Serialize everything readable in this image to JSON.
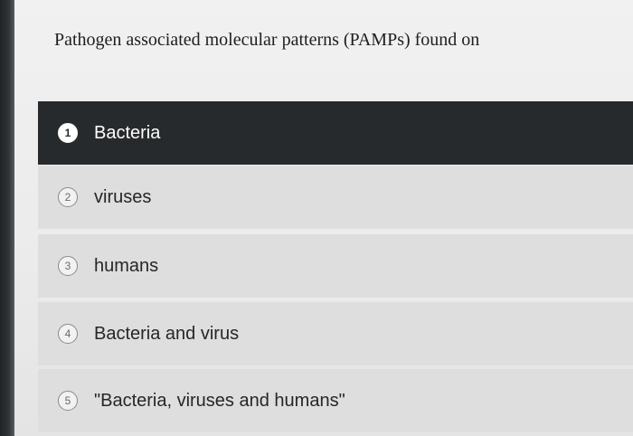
{
  "question": {
    "text": "Pathogen associated molecular patterns (PAMPs) found on"
  },
  "options": [
    {
      "number": "1",
      "label": "Bacteria",
      "selected": true
    },
    {
      "number": "2",
      "label": "viruses",
      "selected": false
    },
    {
      "number": "3",
      "label": "humans",
      "selected": false
    },
    {
      "number": "4",
      "label": "Bacteria and virus",
      "selected": false
    },
    {
      "number": "5",
      "label": "\"Bacteria, viruses and humans\"",
      "selected": false
    }
  ],
  "colors": {
    "selected_background": "#272a2d",
    "option_background": "#dedede",
    "page_background": "#efefef"
  }
}
